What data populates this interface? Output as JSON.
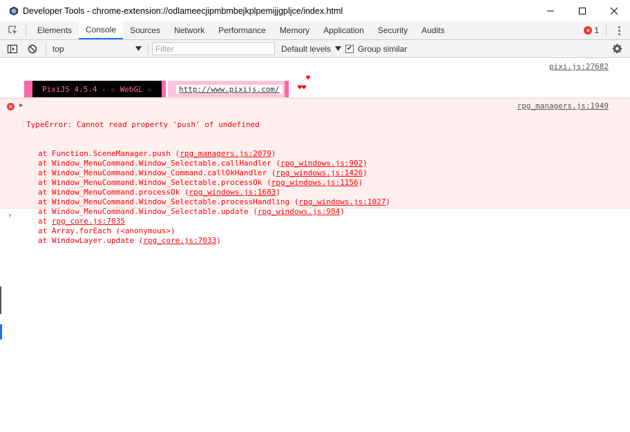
{
  "window": {
    "title": "Developer Tools - chrome-extension://odlameecjipmbmbejkplpemijjgpljce/index.html"
  },
  "tabs": [
    {
      "label": "Elements"
    },
    {
      "label": "Console",
      "selected": true
    },
    {
      "label": "Sources"
    },
    {
      "label": "Network"
    },
    {
      "label": "Performance"
    },
    {
      "label": "Memory"
    },
    {
      "label": "Application"
    },
    {
      "label": "Security"
    },
    {
      "label": "Audits"
    }
  ],
  "error_count": "1",
  "toolbar": {
    "context": "top",
    "filter_placeholder": "Filter",
    "levels": "Default levels",
    "group_similar": "Group similar",
    "group_similar_checked": true
  },
  "console": {
    "pixi": {
      "source": "pixi.js:27682",
      "banner": "PixiJS 4.5.4 - ☆ WebGL ☆",
      "url": "http://www.pixijs.com/",
      "hearts_top": "♥",
      "hearts_bottom": "♥♥"
    },
    "error": {
      "message": "TypeError: Cannot read property 'push' of undefined",
      "source": "rpg_managers.js:1949",
      "stack": [
        {
          "pre": "at Function.SceneManager.push (",
          "link": "rpg_managers.js:2079",
          "post": ")"
        },
        {
          "pre": "at Window_MenuCommand.Window_Selectable.callHandler (",
          "link": "rpg_windows.js:902",
          "post": ")"
        },
        {
          "pre": "at Window_MenuCommand.Window_Command.callOkHandler (",
          "link": "rpg_windows.js:1426",
          "post": ")"
        },
        {
          "pre": "at Window_MenuCommand.Window_Selectable.processOk (",
          "link": "rpg_windows.js:1156",
          "post": ")"
        },
        {
          "pre": "at Window_MenuCommand.processOk (",
          "link": "rpg_windows.js:1683",
          "post": ")"
        },
        {
          "pre": "at Window_MenuCommand.Window_Selectable.processHandling (",
          "link": "rpg_windows.js:1027",
          "post": ")"
        },
        {
          "pre": "at Window_MenuCommand.Window_Selectable.update (",
          "link": "rpg_windows.js:984",
          "post": ")"
        },
        {
          "pre": "at ",
          "link": "rpg_core.js:7035",
          "post": ""
        },
        {
          "pre": "at Array.forEach (<anonymous>)",
          "link": "",
          "post": ""
        },
        {
          "pre": "at WindowLayer.update (",
          "link": "rpg_core.js:7033",
          "post": ")"
        }
      ]
    },
    "prompt": "›"
  },
  "colors": {
    "accent": "#1a73e8",
    "error": "#ff0000",
    "error_bg": "#fff0f0",
    "pixi_pink": "#ff66a5",
    "pixi_light": "#ffc3dc"
  }
}
